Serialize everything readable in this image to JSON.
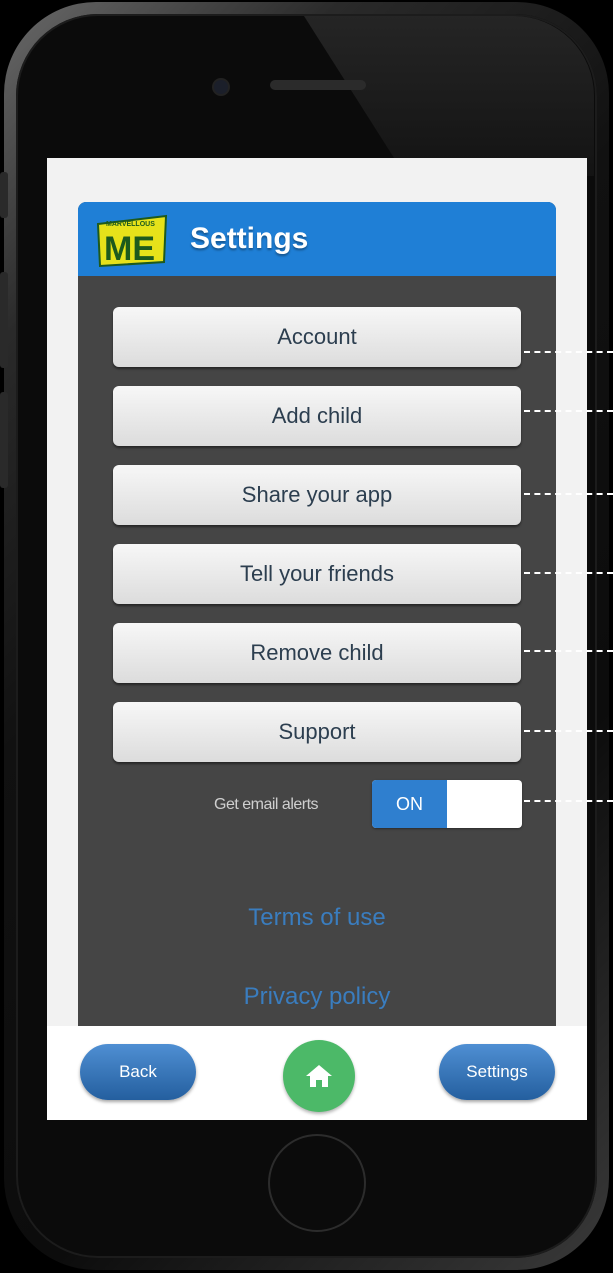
{
  "header": {
    "title": "Settings",
    "logo_text": "MARVELLOUS ME"
  },
  "menu": [
    {
      "label": "Account"
    },
    {
      "label": "Add child"
    },
    {
      "label": "Share your app"
    },
    {
      "label": "Tell your friends"
    },
    {
      "label": "Remove child"
    },
    {
      "label": "Support"
    }
  ],
  "alerts": {
    "label": "Get email alerts",
    "state": "ON"
  },
  "links": {
    "terms": "Terms of use",
    "privacy": "Privacy policy"
  },
  "bottom_nav": {
    "back": "Back",
    "home_icon": "home-icon",
    "settings": "Settings"
  },
  "colors": {
    "header_blue": "#1f7fd6",
    "panel": "#454545",
    "home_green": "#4cb968",
    "link_blue": "#3a7dbf"
  }
}
